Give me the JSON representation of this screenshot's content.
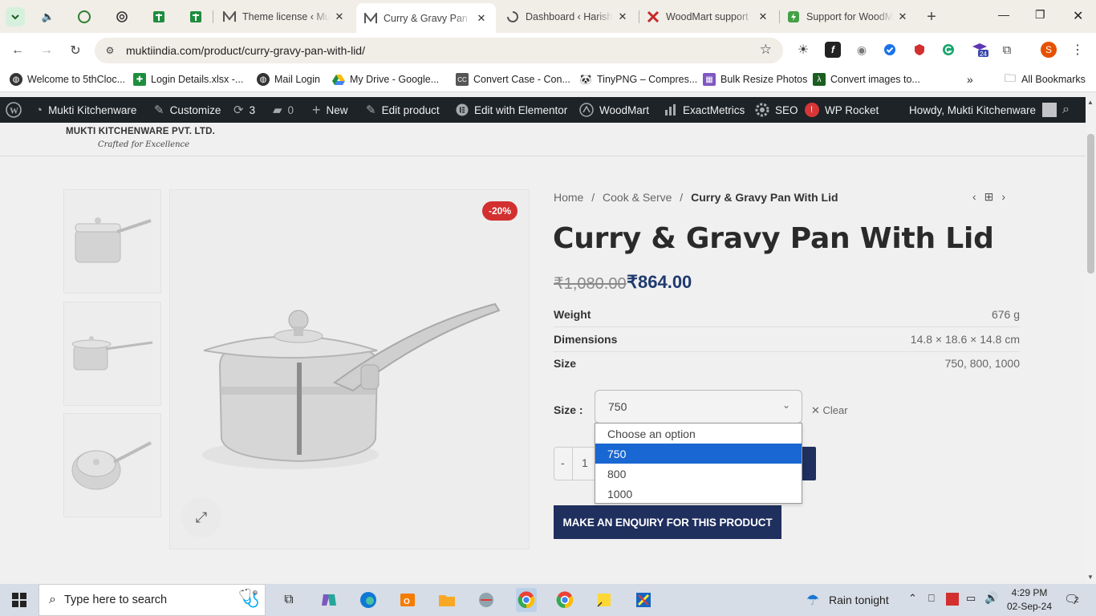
{
  "browser": {
    "tabs": [
      {
        "title": "Theme license ‹ Mukti",
        "icon": "m-logo-icon"
      },
      {
        "title": "Curry & Gravy Pan With",
        "icon": "m-logo-icon",
        "active": true
      },
      {
        "title": "Dashboard ‹ Harish",
        "icon": "loading-icon"
      },
      {
        "title": "WoodMart support",
        "icon": "woodmart-icon"
      },
      {
        "title": "Support for WoodMart",
        "icon": "support-icon"
      }
    ],
    "url": "muktiindia.com/product/curry-gravy-pan-with-lid/",
    "profile_initial": "S",
    "extension_badge": "24",
    "bookmarks": [
      "Welcome to 5thCloc...",
      "Login Details.xlsx -...",
      "Mail Login",
      "My Drive - Google...",
      "Convert Case - Con...",
      "TinyPNG – Compres...",
      "Bulk Resize Photos",
      "Convert images to..."
    ],
    "all_bookmarks": "All Bookmarks"
  },
  "admin_bar": {
    "site_name": "Mukti Kitchenware",
    "customize": "Customize",
    "updates": "3",
    "comments": "0",
    "new": "New",
    "edit_product": "Edit product",
    "edit_elementor": "Edit with Elementor",
    "woodmart": "WoodMart",
    "exactmetrics": "ExactMetrics",
    "seo": "SEO",
    "seo_badge": "!",
    "wp_rocket": "WP Rocket",
    "howdy": "Howdy, Mukti Kitchenware"
  },
  "site": {
    "logo_line1": "MUKTI KITCHENWARE PVT. LTD.",
    "logo_line2": "Crafted for Excellence"
  },
  "product": {
    "breadcrumb": [
      "Home",
      "Cook & Serve",
      "Curry & Gravy Pan With Lid"
    ],
    "title": "Curry & Gravy Pan With Lid",
    "sale_badge": "-20%",
    "old_price": "₹1,080.00",
    "new_price": "₹864.00",
    "attributes": [
      {
        "key": "Weight",
        "value": "676 g"
      },
      {
        "key": "Dimensions",
        "value": "14.8 × 18.6 × 14.8 cm"
      },
      {
        "key": "Size",
        "value": "750, 800, 1000"
      }
    ],
    "size_label": "Size :",
    "size_selected": "750",
    "clear_label": "Clear",
    "size_options": [
      "Choose an option",
      "750",
      "800",
      "1000"
    ],
    "qty_minus": "-",
    "qty_value": "1",
    "enquiry_button": "MAKE AN ENQUIRY FOR THIS PRODUCT"
  },
  "taskbar": {
    "search_placeholder": "Type here to search",
    "weather": "Rain tonight",
    "time": "4:29 PM",
    "date": "02-Sep-24",
    "notifications": "2"
  }
}
